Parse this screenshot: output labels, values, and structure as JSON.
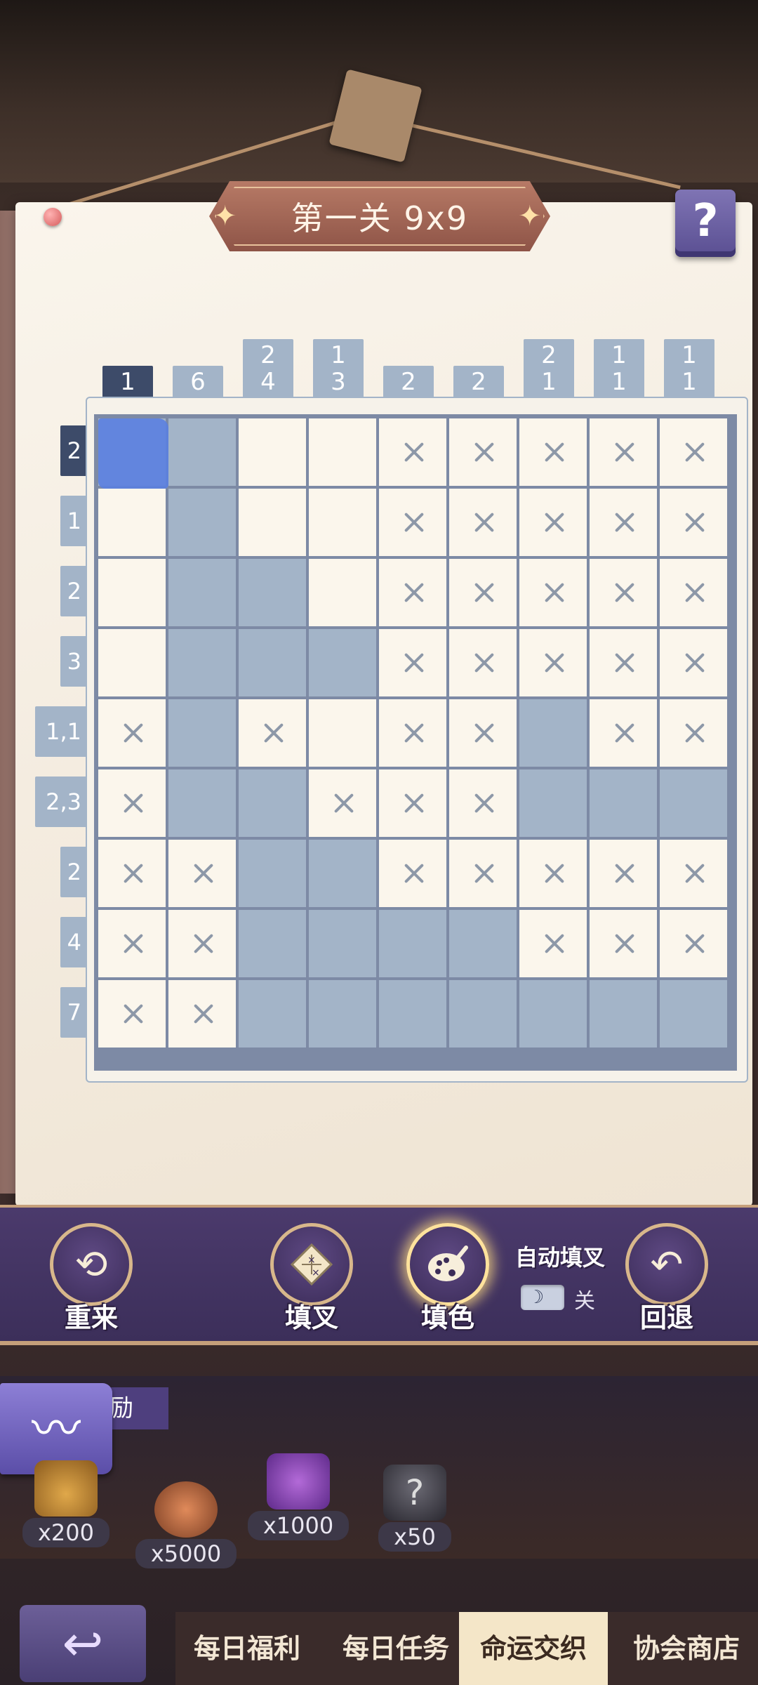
{
  "level": {
    "title": "第一关 9x9",
    "help_label": "?"
  },
  "puzzle": {
    "column_clues": [
      [
        "1"
      ],
      [
        "6"
      ],
      [
        "2",
        "4"
      ],
      [
        "1",
        "3"
      ],
      [
        "2"
      ],
      [
        "2"
      ],
      [
        "2",
        "1"
      ],
      [
        "1",
        "1"
      ],
      [
        "1",
        "1"
      ]
    ],
    "row_clues": [
      "2",
      "1",
      "2",
      "3",
      "1,1",
      "2,3",
      "2",
      "4",
      "7"
    ],
    "active_column": 0,
    "active_row": 0,
    "cursor_cell": [
      0,
      0
    ],
    "grid": [
      "FFEEXXXXX",
      "EFEEXXXXX",
      "EFFEXXXXX",
      "EFFFXXXXX",
      "XFXEXXFXX",
      "XFFXXXFFF",
      "XXFFXXXXX",
      "XXFFFFXXX",
      "XXFFFFFFF"
    ],
    "colors": {
      "filled": "#a3b4c8",
      "empty": "#fbf6ec",
      "cross": "#8d98a8",
      "active_clue": "#3d4b69"
    }
  },
  "toolbar": {
    "restart_label": "重来",
    "mark_x_label": "填叉",
    "fill_label": "填色",
    "auto_x_label": "自动填叉",
    "auto_x_state": "关",
    "undo_label": "回退",
    "selected_tool": "fill"
  },
  "rewards": {
    "title": "励",
    "items": [
      {
        "name": "coin-bag",
        "count": "x200"
      },
      {
        "name": "medal",
        "count": "x5000"
      },
      {
        "name": "puzzle-piece",
        "count": "x1000"
      },
      {
        "name": "mystery-character",
        "count": "x50"
      }
    ]
  },
  "bottom_tabs": [
    {
      "label": "每日福利",
      "active": false
    },
    {
      "label": "每日任务",
      "active": false
    },
    {
      "label": "命运交织",
      "active": true
    },
    {
      "label": "协会商店",
      "active": false
    }
  ]
}
